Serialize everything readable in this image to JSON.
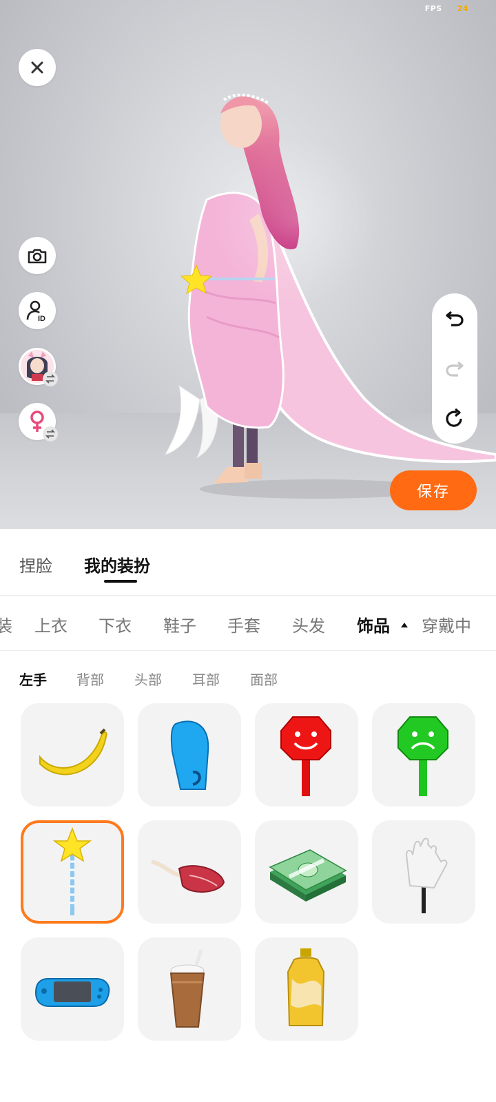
{
  "fps": {
    "label": "FPS",
    "value": "24"
  },
  "viewport": {
    "close_icon": "close-icon",
    "left_tools": [
      {
        "name": "camera-button",
        "icon": "camera-icon"
      },
      {
        "name": "profile-id-button",
        "icon": "user-id-icon"
      },
      {
        "name": "avatar-switch-button",
        "icon": "avatar-thumbnail"
      },
      {
        "name": "gender-switch-button",
        "icon": "female-icon"
      }
    ],
    "history": [
      "undo-icon",
      "redo-icon",
      "reset-icon"
    ],
    "save_label": "保存"
  },
  "main_tabs": [
    {
      "label": "捏脸",
      "active": false
    },
    {
      "label": "我的装扮",
      "active": true
    }
  ],
  "categories": [
    {
      "label": "套装",
      "active": false
    },
    {
      "label": "上衣",
      "active": false
    },
    {
      "label": "下衣",
      "active": false
    },
    {
      "label": "鞋子",
      "active": false
    },
    {
      "label": "手套",
      "active": false
    },
    {
      "label": "头发",
      "active": false
    },
    {
      "label": "饰品",
      "active": true
    },
    {
      "label": "穿戴中",
      "active": false
    }
  ],
  "subcategories": [
    {
      "label": "左手",
      "active": true
    },
    {
      "label": "背部",
      "active": false
    },
    {
      "label": "头部",
      "active": false
    },
    {
      "label": "耳部",
      "active": false
    },
    {
      "label": "面部",
      "active": false
    }
  ],
  "items": [
    {
      "icon": "banana-icon",
      "selected": false
    },
    {
      "icon": "boxing-glove-icon",
      "selected": false
    },
    {
      "icon": "happy-sign-icon",
      "selected": false
    },
    {
      "icon": "sad-sign-icon",
      "selected": false
    },
    {
      "icon": "star-wand-icon",
      "selected": true
    },
    {
      "icon": "steak-icon",
      "selected": false
    },
    {
      "icon": "cash-stack-icon",
      "selected": false
    },
    {
      "icon": "foam-hand-icon",
      "selected": false
    },
    {
      "icon": "game-console-icon",
      "selected": false
    },
    {
      "icon": "drink-cup-icon",
      "selected": false
    },
    {
      "icon": "bottle-icon",
      "selected": false
    }
  ],
  "colors": {
    "accent": "#ff6a13",
    "selected_border": "#ff7a1c",
    "fps_value": "#f0a800"
  }
}
